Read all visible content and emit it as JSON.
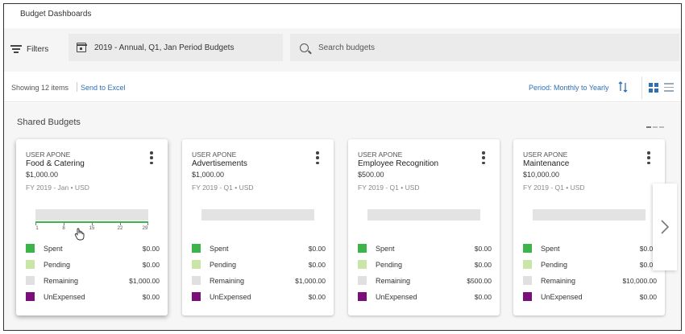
{
  "window": {
    "title": "Budget Dashboards"
  },
  "filterbar": {
    "filters_label": "Filters",
    "period_label": "2019 - Annual, Q1, Jan Period Budgets",
    "search_placeholder": "Search budgets",
    "search_value": ""
  },
  "toolbar": {
    "showing": "Showing 12 items",
    "send_to_excel": "Send to Excel",
    "period_select": "Period: Monthly to Yearly"
  },
  "section": {
    "title": "Shared Budgets"
  },
  "legend_labels": {
    "spent": "Spent",
    "pending": "Pending",
    "remaining": "Remaining",
    "unexpensed": "UnExpensed"
  },
  "colors": {
    "spent": "#3cb44a",
    "pending": "#c7e6a8",
    "remaining": "#e0e0e0",
    "unexpensed": "#7b0f7a",
    "accent": "#2f6fb3"
  },
  "cards": [
    {
      "owner": "USER APONE",
      "name": "Food & Catering",
      "amount": "$1,000.00",
      "period": "FY 2019 - Jan • USD",
      "axis_ticks": [
        "1",
        "8",
        "15",
        "22",
        "29"
      ],
      "values": {
        "spent": "$0.00",
        "pending": "$0.00",
        "remaining": "$1,000.00",
        "unexpensed": "$0.00"
      }
    },
    {
      "owner": "USER APONE",
      "name": "Advertisements",
      "amount": "$1,000.00",
      "period": "FY 2019 - Q1 • USD",
      "values": {
        "spent": "$0.00",
        "pending": "$0.00",
        "remaining": "$1,000.00",
        "unexpensed": "$0.00"
      }
    },
    {
      "owner": "USER APONE",
      "name": "Employee Recognition",
      "amount": "$500.00",
      "period": "FY 2019 - Q1 • USD",
      "values": {
        "spent": "$0.00",
        "pending": "$0.00",
        "remaining": "$500.00",
        "unexpensed": "$0.00"
      }
    },
    {
      "owner": "USER APONE",
      "name": "Maintenance",
      "amount": "$10,000.00",
      "period": "FY 2019 - Q1 • USD",
      "values": {
        "spent": "$0.00",
        "pending": "$0.00",
        "remaining": "$10,000.00",
        "unexpensed": "$0.00"
      }
    }
  ]
}
